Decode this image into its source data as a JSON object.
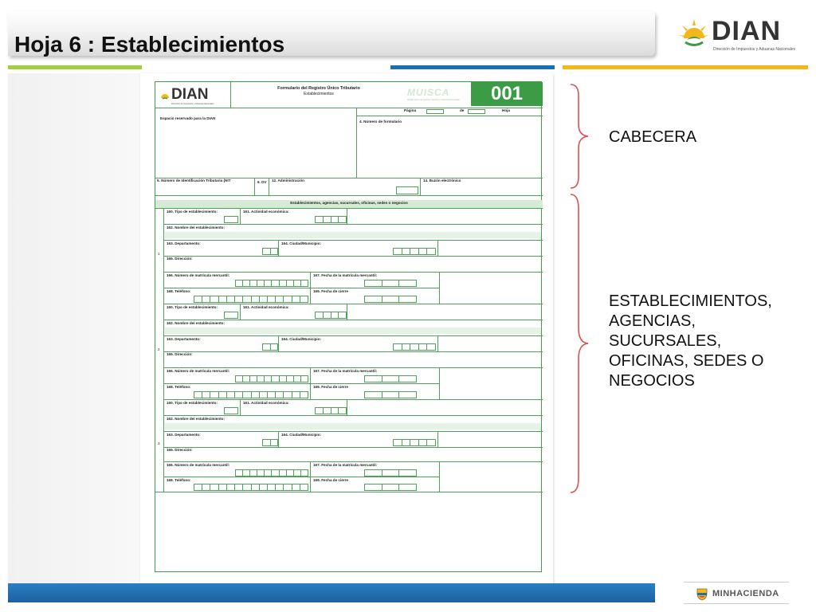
{
  "slide": {
    "title": "Hoja 6 : Establecimientos",
    "logo": {
      "text": "DIAN",
      "subtitle": "Dirección de Impuestos y Aduanas Nacionales"
    },
    "footer_logo": "MINHACIENDA"
  },
  "form": {
    "header": {
      "logo_text": "DIAN",
      "logo_subtitle": "Dirección de Impuestos y Aduanas Nacionales",
      "title": "Formulario del Registro Único Tributario",
      "subtitle": "Establecimientos",
      "muisca": "MUISCA",
      "muisca_subtitle": "Modelo Único de Ingresos, Servicio y Control Automatizado",
      "number": "001",
      "page_label": "Página",
      "of_label": "de",
      "sheet_label": "Hoja",
      "reserved": "Espacio reservado para la DIAN",
      "form_number": "4. Número de formulario",
      "nit": "5. Número de Identificación Tributaria (NIT",
      "dv": "6. DV",
      "admin": "12. Administración",
      "email": "14. Buzón electrónico"
    },
    "section_title": "Establecimientos, agencias, sucursales, oficinas, sedes o negocios",
    "fields": {
      "tipo": "160. Tipo de establecimiento:",
      "actividad": "161. Actividad económica:",
      "nombre": "162. Nombre del establecimiento:",
      "departamento": "163. Departamento:",
      "ciudad": "164. Ciudad/Municipio:",
      "direccion": "165. Dirección:",
      "matricula": "166. Número de matrícula mercantil:",
      "fecha_matricula": "167. Fecha de la matrícula mercantil:",
      "telefono": "168. Teléfono:",
      "fecha_cierre": "169. Fecha de cierre"
    },
    "blocks": [
      {
        "index": "1"
      },
      {
        "index": "2"
      },
      {
        "index": "3"
      }
    ]
  },
  "annotations": {
    "header": "CABECERA",
    "body": [
      "ESTABLECIMIENTOS,",
      "AGENCIAS,",
      "SUCURSALES,",
      "OFICINAS, SEDES O",
      "NEGOCIOS"
    ]
  },
  "colors": {
    "form_green": "#3c9b45",
    "rule_green": "#a2cf3d",
    "rule_blue": "#1b6fb3",
    "rule_yellow": "#f2b81b",
    "brace_red": "#d9534f"
  }
}
